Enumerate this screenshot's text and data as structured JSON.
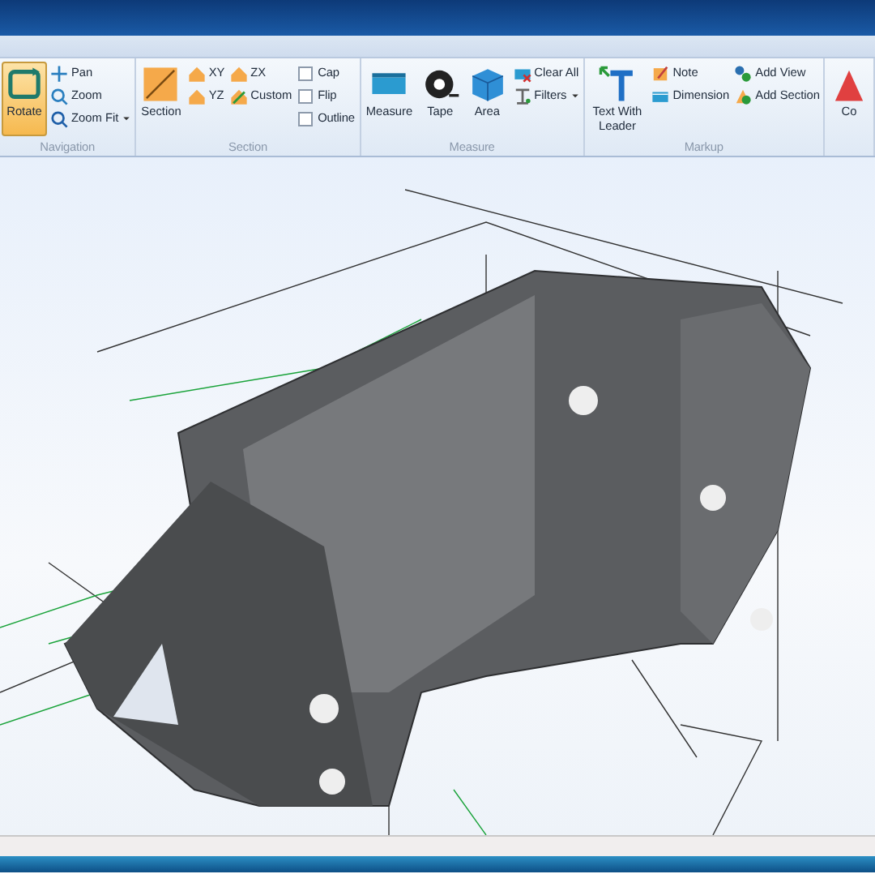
{
  "ribbon": {
    "groups": [
      {
        "label": "Navigation",
        "columns": [
          [
            {
              "kind": "large",
              "label": "Rotate",
              "selected": true
            }
          ],
          [
            {
              "kind": "small",
              "label": "Pan",
              "dropdown": false
            },
            {
              "kind": "small",
              "label": "Zoom",
              "dropdown": false
            },
            {
              "kind": "small",
              "label": "Zoom Fit",
              "dropdown": true
            }
          ]
        ]
      },
      {
        "label": "Section",
        "columns": [
          [
            {
              "kind": "large",
              "label": "Section",
              "selected": false
            }
          ],
          [
            {
              "kind": "small",
              "label": "XY",
              "dropdown": false
            },
            {
              "kind": "small",
              "label": "YZ",
              "dropdown": false
            }
          ],
          [
            {
              "kind": "small",
              "label": "ZX",
              "dropdown": false
            },
            {
              "kind": "small",
              "label": "Custom",
              "dropdown": false
            }
          ],
          [
            {
              "kind": "checkbox",
              "label": "Cap",
              "checked": false
            },
            {
              "kind": "checkbox",
              "label": "Flip",
              "checked": false
            },
            {
              "kind": "checkbox",
              "label": "Outline",
              "checked": false
            }
          ]
        ]
      },
      {
        "label": "Measure",
        "columns": [
          [
            {
              "kind": "large",
              "label": "Measure",
              "selected": false
            }
          ],
          [
            {
              "kind": "large",
              "label": "Tape",
              "selected": false
            }
          ],
          [
            {
              "kind": "large",
              "label": "Area",
              "selected": false
            }
          ],
          [
            {
              "kind": "small",
              "label": "Clear All",
              "dropdown": false
            },
            {
              "kind": "small",
              "label": "Filters",
              "dropdown": true
            }
          ]
        ]
      },
      {
        "label": "Markup",
        "columns": [
          [
            {
              "kind": "large",
              "label": "Text With Leader",
              "selected": false
            }
          ],
          [
            {
              "kind": "small",
              "label": "Note",
              "dropdown": false
            },
            {
              "kind": "small",
              "label": "Dimension",
              "dropdown": false
            }
          ],
          [
            {
              "kind": "small",
              "label": "Add View",
              "dropdown": false
            },
            {
              "kind": "small",
              "label": "Add Section",
              "dropdown": false
            }
          ]
        ]
      },
      {
        "columns": [
          [
            {
              "kind": "large",
              "label": "Co",
              "selected": false
            }
          ]
        ]
      }
    ]
  }
}
